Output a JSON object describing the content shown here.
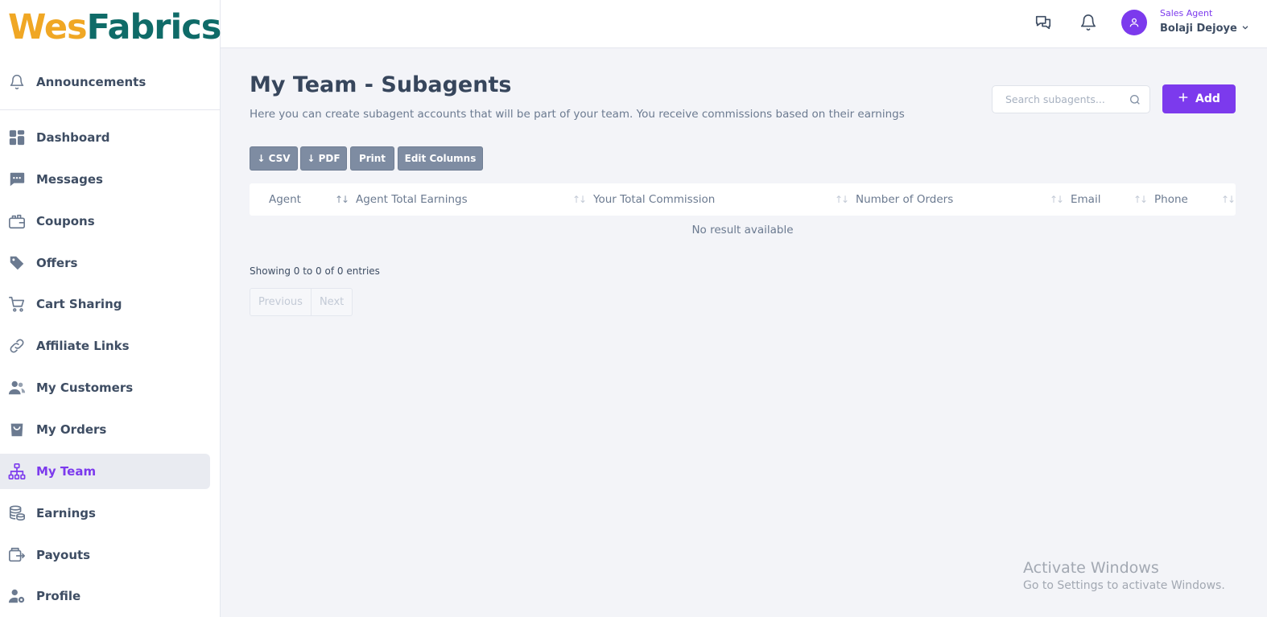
{
  "brand": {
    "part1": "Wes",
    "part2": "Fabrics"
  },
  "sidebar": {
    "announcements": {
      "label": "Announcements",
      "icon": "bell-icon"
    },
    "items": [
      {
        "label": "Dashboard",
        "icon": "dashboard-icon"
      },
      {
        "label": "Messages",
        "icon": "message-icon"
      },
      {
        "label": "Coupons",
        "icon": "coupon-icon"
      },
      {
        "label": "Offers",
        "icon": "tag-icon"
      },
      {
        "label": "Cart Sharing",
        "icon": "cart-icon"
      },
      {
        "label": "Affiliate Links",
        "icon": "link-icon"
      },
      {
        "label": "My Customers",
        "icon": "users-icon"
      },
      {
        "label": "My Orders",
        "icon": "shopping-bag-icon"
      },
      {
        "label": "My Team",
        "icon": "org-chart-icon",
        "active": true
      },
      {
        "label": "Earnings",
        "icon": "coins-icon"
      },
      {
        "label": "Payouts",
        "icon": "payout-icon"
      },
      {
        "label": "Profile",
        "icon": "user-settings-icon"
      }
    ]
  },
  "header": {
    "role": "Sales Agent",
    "user_name": "Bolaji Dejoye"
  },
  "page": {
    "title": "My Team - Subagents",
    "subtitle": "Here you can create subagent accounts that will be part of your team. You receive commissions based on their earnings",
    "search_placeholder": "Search subagents...",
    "add_label": "Add"
  },
  "toolbar": {
    "csv": "↓ CSV",
    "pdf": "↓ PDF",
    "print": "Print",
    "edit_columns": "Edit Columns"
  },
  "table": {
    "columns": [
      "Agent",
      "Agent Total Earnings",
      "Your Total Commission",
      "Number of Orders",
      "Email",
      "Phone"
    ],
    "empty_text": "No result available",
    "showing": "Showing 0 to 0 of 0 entries",
    "prev": "Previous",
    "next": "Next"
  },
  "watermark": {
    "line1": "Activate Windows",
    "line2": "Go to Settings to activate Windows."
  },
  "colors": {
    "accent": "#7c3aed",
    "brand_orange": "#f0a724",
    "brand_teal": "#0f6b68",
    "button_gray": "#7e8ca2"
  }
}
